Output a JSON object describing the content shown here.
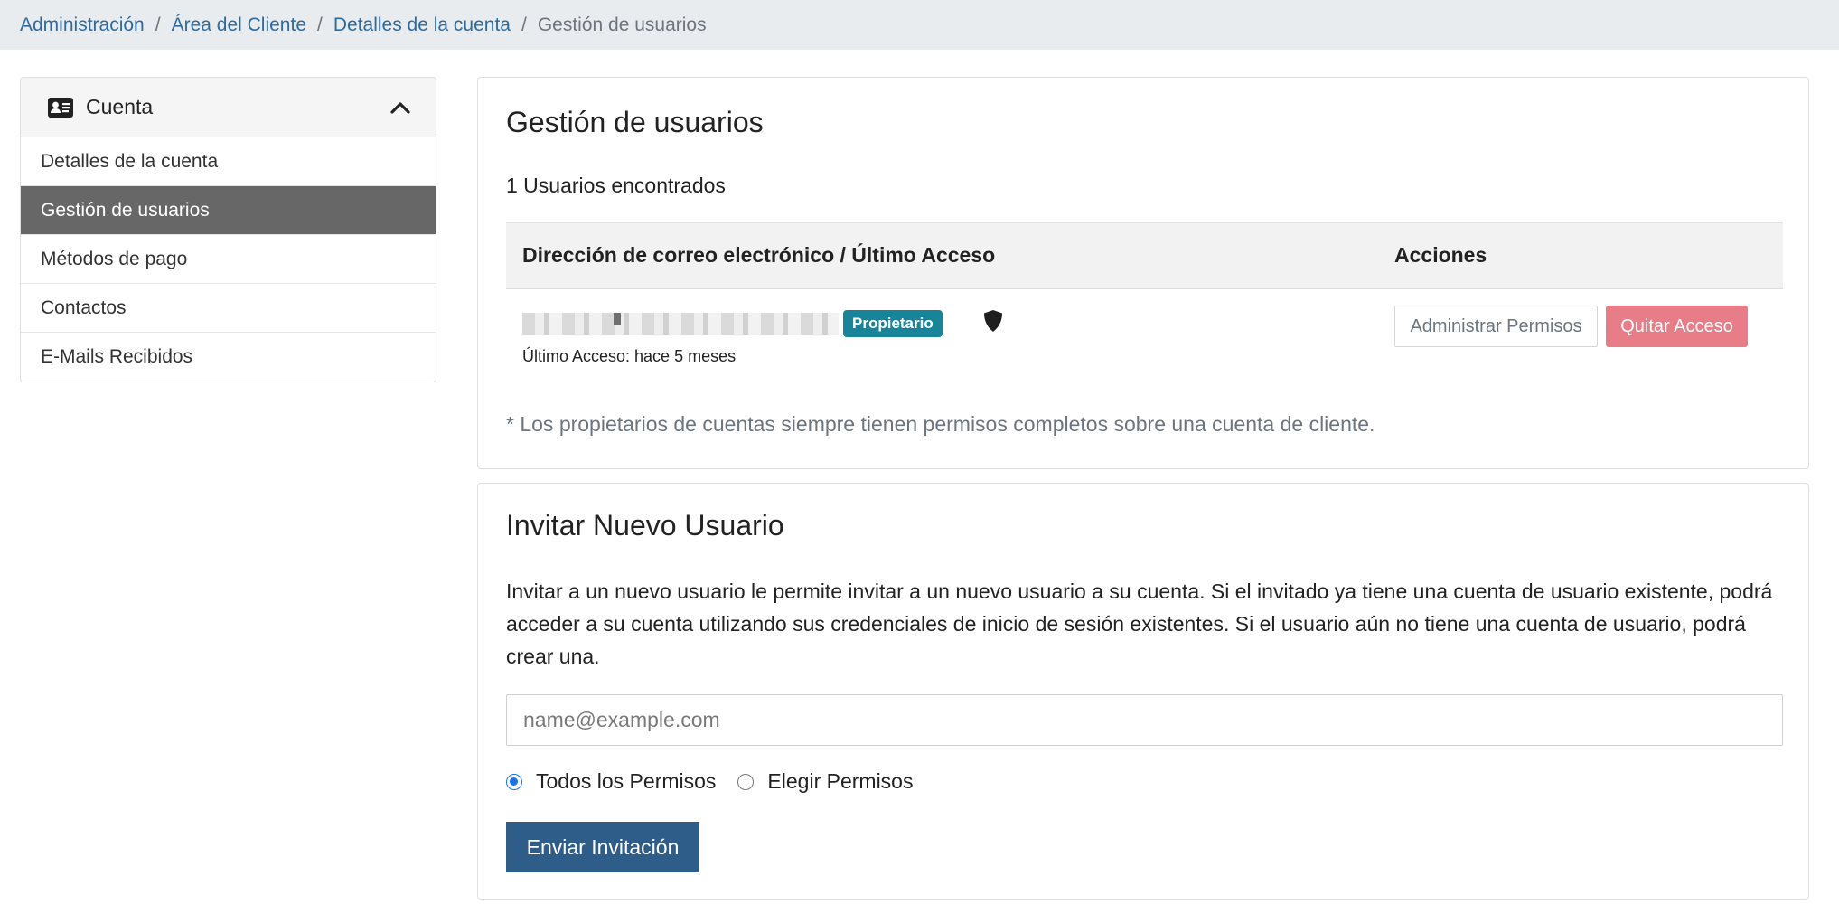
{
  "breadcrumb": {
    "items": [
      "Administración",
      "Área del Cliente",
      "Detalles de la cuenta"
    ],
    "current": "Gestión de usuarios",
    "separator": "/"
  },
  "sidebar": {
    "title": "Cuenta",
    "header_icon": "id-card-icon",
    "toggle_icon": "chevron-up-icon",
    "items": [
      {
        "label": "Detalles de la cuenta",
        "active": false
      },
      {
        "label": "Gestión de usuarios",
        "active": true
      },
      {
        "label": "Métodos de pago",
        "active": false
      },
      {
        "label": "Contactos",
        "active": false
      },
      {
        "label": "E-Mails Recibidos",
        "active": false
      }
    ]
  },
  "users_card": {
    "title": "Gestión de usuarios",
    "count_text": "1 Usuarios encontrados",
    "columns": [
      "Dirección de correo electrónico / Último Acceso",
      "Acciones"
    ],
    "rows": [
      {
        "email": "",
        "badge": "Propietario",
        "badge_color": "#17849a",
        "owner_icon": "shield-icon",
        "last_access": "Último Acceso: hace 5 meses",
        "actions": [
          "Administrar Permisos",
          "Quitar Acceso"
        ]
      }
    ],
    "note": "* Los propietarios de cuentas siempre tienen permisos completos sobre una cuenta de cliente."
  },
  "invite_card": {
    "title": "Invitar Nuevo Usuario",
    "description": "Invitar a un nuevo usuario le permite invitar a un nuevo usuario a su cuenta. Si el invitado ya tiene una cuenta de usuario existente, podrá acceder a su cuenta utilizando sus credenciales de inicio de sesión existentes. Si el usuario aún no tiene una cuenta de usuario, podrá crear una.",
    "email_placeholder": "name@example.com",
    "email_value": "",
    "permission_options": [
      {
        "label": "Todos los Permisos",
        "selected": true
      },
      {
        "label": "Elegir Permisos",
        "selected": false
      }
    ],
    "submit_label": "Enviar Invitación"
  },
  "colors": {
    "link": "#2c6aa0",
    "active_sidebar": "#676767",
    "danger_button": "#e87c87",
    "primary_button": "#2f5d8a",
    "radio_accent": "#1a73e8"
  }
}
